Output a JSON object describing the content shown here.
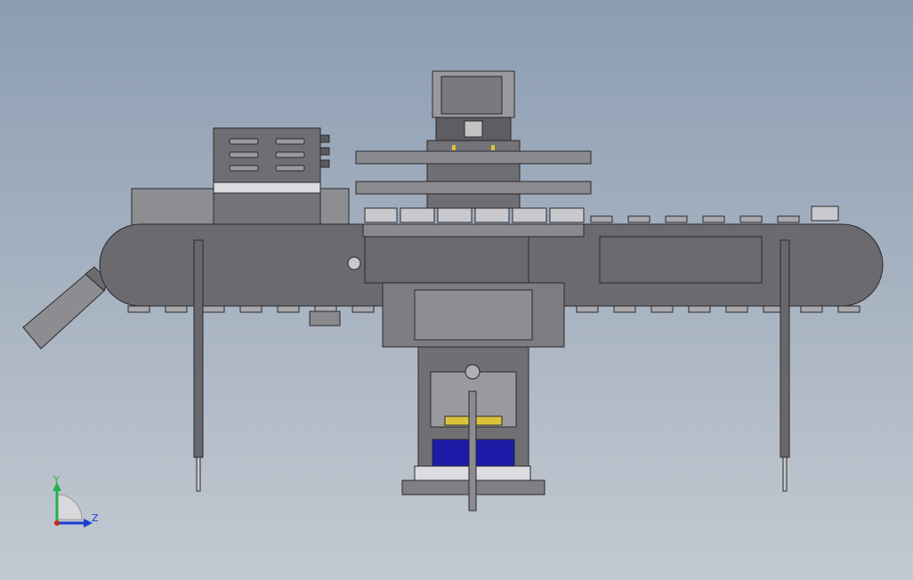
{
  "viewport": {
    "background_top": "#8c9db2",
    "background_bottom": "#c3c9d1"
  },
  "triad": {
    "y_label": "Y",
    "z_label": "Z",
    "y_color": "#22b14c",
    "z_color": "#1a3fd1",
    "origin_color": "#d42020"
  },
  "colors": {
    "frame": "#6f6f73",
    "frame_dark": "#4d4d52",
    "panel": "#7a7a7e",
    "light_panel": "#c6c6c9",
    "outline": "#2a2a2e",
    "blue_block": "#1b1ba8",
    "yellow_part": "#d8c23a"
  }
}
